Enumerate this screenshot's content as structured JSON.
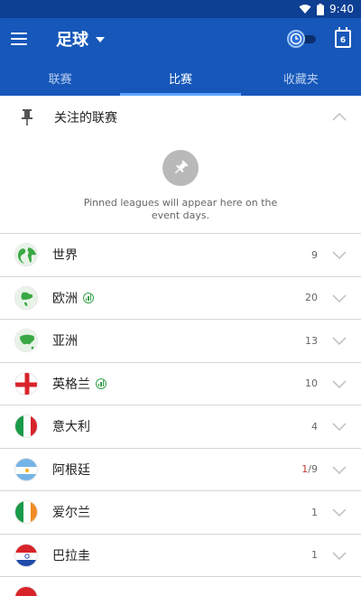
{
  "status_bar": {
    "time": "9:40"
  },
  "app_bar": {
    "title": "足球",
    "calendar_day": "6"
  },
  "tabs": [
    {
      "label": "联赛",
      "active": false
    },
    {
      "label": "比赛",
      "active": true
    },
    {
      "label": "收藏夹",
      "active": false
    }
  ],
  "pinned": {
    "title": "关注的联赛",
    "empty_message": "Pinned leagues will appear here on the event days."
  },
  "leagues": [
    {
      "name": "世界",
      "count": "9",
      "live_count": "",
      "has_live_badge": false,
      "flag": "world-globe-icon"
    },
    {
      "name": "欧洲",
      "count": "20",
      "live_count": "",
      "has_live_badge": true,
      "flag": "europe-globe-icon"
    },
    {
      "name": "亚洲",
      "count": "13",
      "live_count": "",
      "has_live_badge": false,
      "flag": "asia-globe-icon"
    },
    {
      "name": "英格兰",
      "count": "10",
      "live_count": "",
      "has_live_badge": true,
      "flag": "england-flag-icon"
    },
    {
      "name": "意大利",
      "count": "4",
      "live_count": "",
      "has_live_badge": false,
      "flag": "italy-flag-icon"
    },
    {
      "name": "阿根廷",
      "count": "/9",
      "live_count": "1",
      "has_live_badge": false,
      "flag": "argentina-flag-icon"
    },
    {
      "name": "爱尔兰",
      "count": "1",
      "live_count": "",
      "has_live_badge": false,
      "flag": "ireland-flag-icon"
    },
    {
      "name": "巴拉圭",
      "count": "1",
      "live_count": "",
      "has_live_badge": false,
      "flag": "paraguay-flag-icon"
    }
  ],
  "colors": {
    "status_bar": "#0d3f93",
    "app_bar": "#1657b9",
    "tab_indicator": "#5ea3ff",
    "live_green": "#35a24a",
    "live_red": "#c0392b"
  }
}
